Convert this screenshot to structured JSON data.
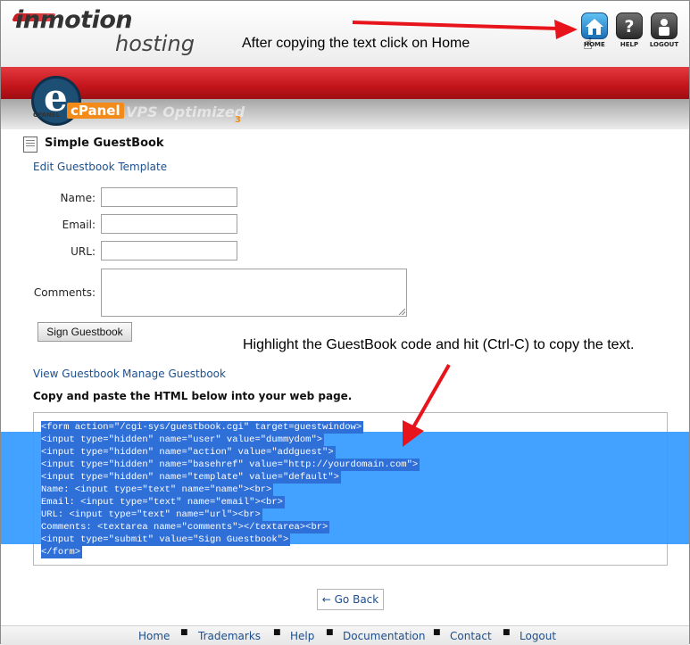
{
  "header": {
    "logo_line1": "inmotion",
    "logo_line2": "hosting",
    "annotation": "After copying the text click on Home",
    "buttons": [
      {
        "label": "HOME",
        "icon": "home-icon"
      },
      {
        "label": "HELP",
        "icon": "question-icon"
      },
      {
        "label": "LOGOUT",
        "icon": "user-icon"
      }
    ]
  },
  "cpanel": {
    "label": "cPanel",
    "mini": "CPANEL",
    "edition": "VPS Optimized",
    "version": "3"
  },
  "page": {
    "title": "Simple GuestBook",
    "edit_link": "Edit Guestbook Template",
    "fields": {
      "name_label": "Name:",
      "email_label": "Email:",
      "url_label": "URL:",
      "comments_label": "Comments:"
    },
    "sign_button": "Sign Guestbook",
    "annotation": "Highlight the GuestBook code and hit (Ctrl-C) to copy the text.",
    "view_link": "View Guestbook",
    "manage_link": "Manage Guestbook",
    "copy_instructions": "Copy and paste the HTML below into your web page.",
    "code_lines": [
      "<form action=\"/cgi-sys/guestbook.cgi\" target=guestwindow>",
      "<input type=\"hidden\" name=\"user\" value=\"dummydom\">",
      "<input type=\"hidden\" name=\"action\" value=\"addguest\">",
      "<input type=\"hidden\" name=\"basehref\" value=\"http://yourdomain.com\">",
      "<input type=\"hidden\" name=\"template\" value=\"default\">",
      "Name: <input type=\"text\" name=\"name\"><br>",
      "Email: <input type=\"text\" name=\"email\"><br>",
      "URL: <input type=\"text\" name=\"url\"><br>",
      "Comments: <textarea name=\"comments\"></textarea><br>",
      "<input type=\"submit\" value=\"Sign Guestbook\">",
      "</form>"
    ],
    "go_back": "← Go Back"
  },
  "footer": {
    "items": [
      "Home",
      "Trademarks",
      "Help",
      "Documentation",
      "Contact",
      "Logout"
    ],
    "separator": "■"
  },
  "colors": {
    "brand_red": "#c3151b",
    "link_blue": "#1d4f8c",
    "highlight": "#3399ff",
    "annotation_arrow": "#e8141b"
  }
}
